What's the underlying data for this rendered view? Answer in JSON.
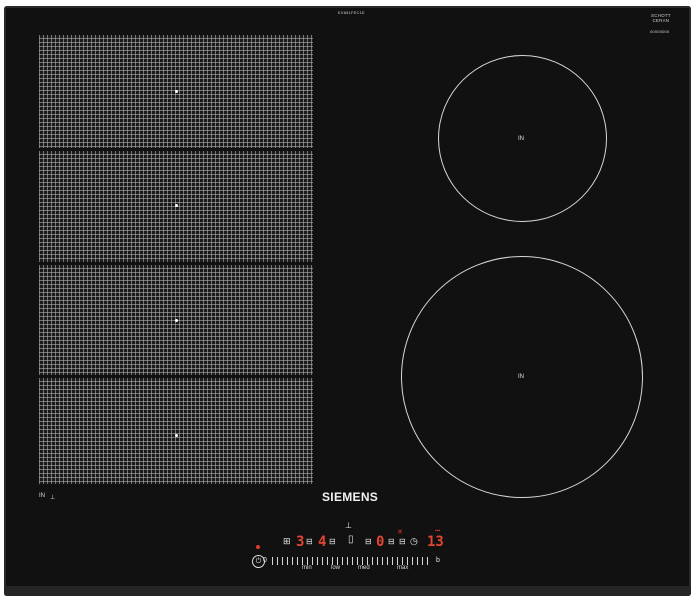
{
  "panel": {
    "model_code": "EX651FEC1E",
    "glass_brand": "SCHOTT\nCERAN",
    "serial": "00000000",
    "brand_name": "SIEMENS"
  },
  "zones": {
    "flex_label": "IN",
    "flex_icon": "⊥",
    "upper_right_label": "IN",
    "lower_right_label": "IN"
  },
  "controls": {
    "zone_select_icon": "⊥",
    "display_left_value": "3",
    "display_mid_value": "4",
    "display_center_value": "0",
    "timer_icon": "clock-icon",
    "timer_value": "13",
    "power_symbol": "⏻",
    "zero_label": "0",
    "boost_label": "b",
    "slider_labels": [
      "min",
      "low",
      "med",
      "max"
    ]
  }
}
